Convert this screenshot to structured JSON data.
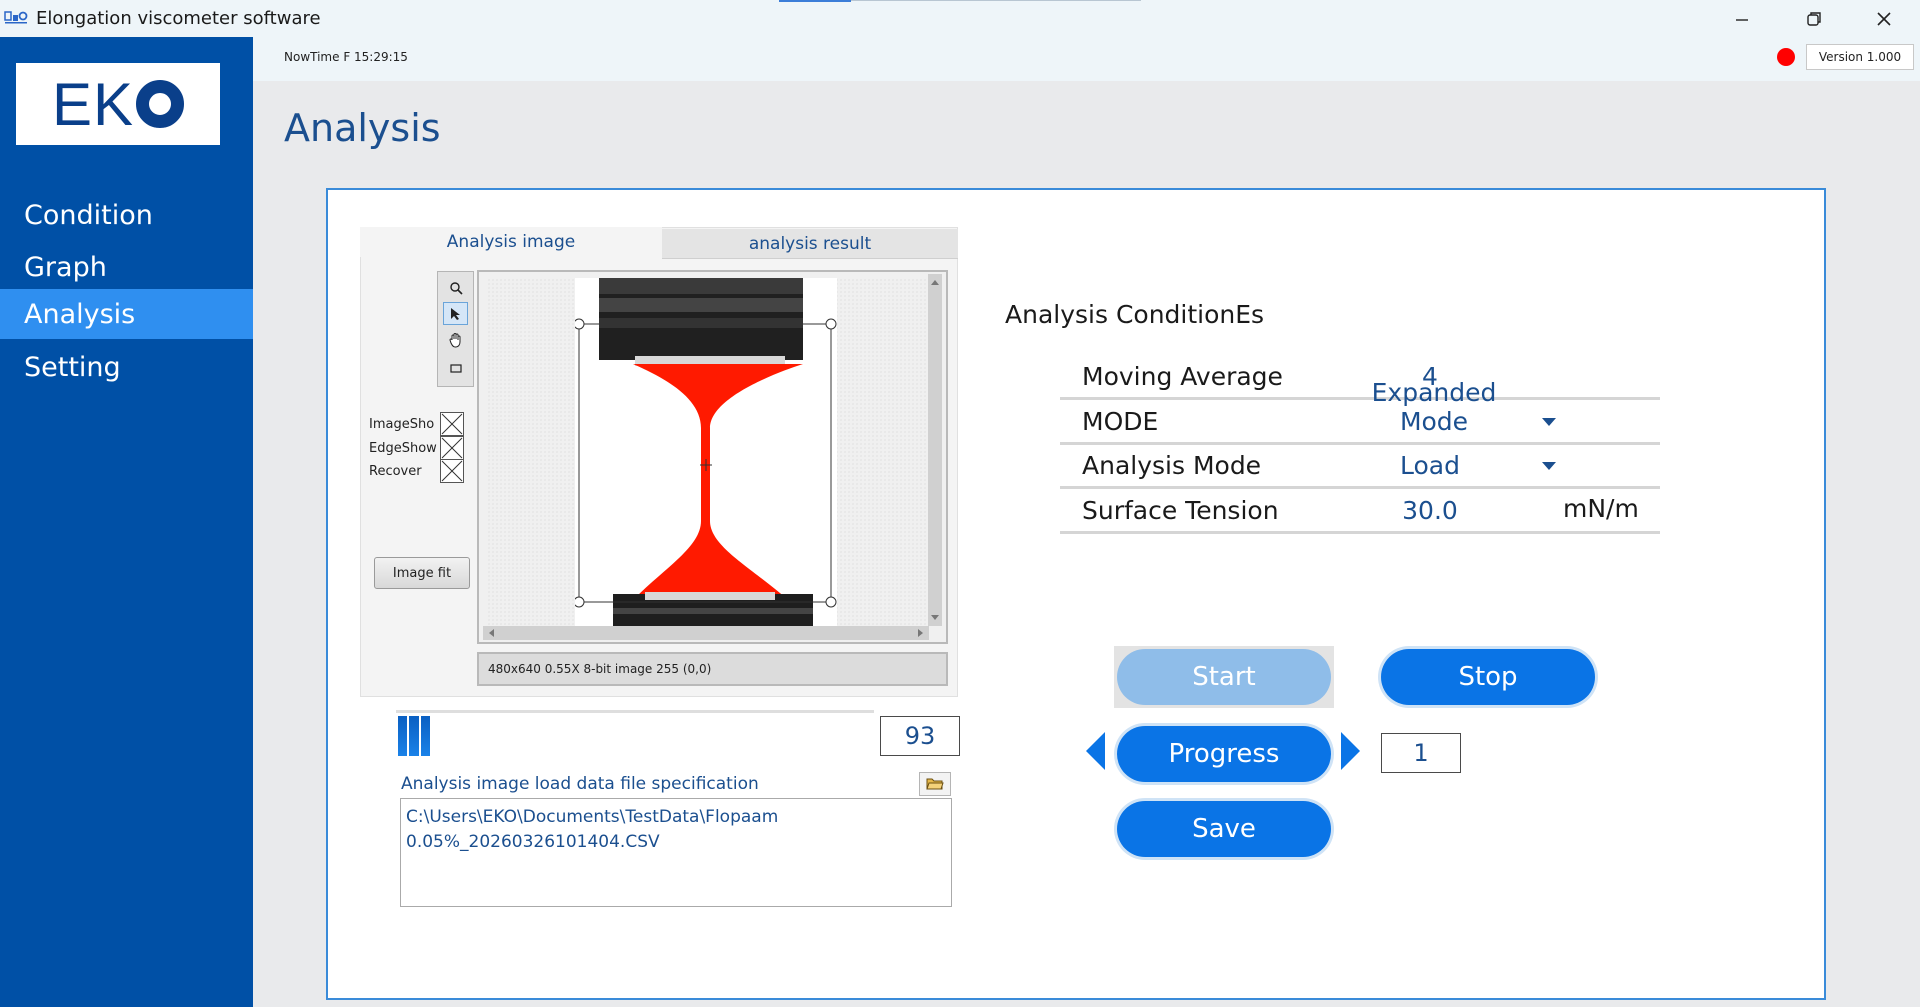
{
  "window": {
    "title": "Elongation viscometer software",
    "minimize_icon": "minimize-icon",
    "maximize_icon": "restore-icon",
    "close_icon": "close-icon"
  },
  "sidebar": {
    "logo_text": "EKO",
    "items": [
      {
        "label": "Condition",
        "active": false
      },
      {
        "label": "Graph",
        "active": false
      },
      {
        "label": "Analysis",
        "active": true
      },
      {
        "label": "Setting",
        "active": false
      }
    ]
  },
  "header": {
    "now_time": "NowTime F  15:29:15",
    "status_color": "#ff0000",
    "version": "Version 1.000"
  },
  "page_title": "Analysis",
  "tabs": [
    {
      "label": "Analysis image",
      "active": true
    },
    {
      "label": "analysis result",
      "active": false
    }
  ],
  "tools": [
    "zoom-icon",
    "pointer-icon",
    "hand-icon",
    "rectangle-icon"
  ],
  "checkboxes": [
    {
      "label": "ImageSho"
    },
    {
      "label": "EdgeShow"
    },
    {
      "label": "Recover"
    }
  ],
  "image_fit_label": "Image fit",
  "image_info": "480x640 0.55X 8-bit image 255    (0,0)",
  "frame_value": "93",
  "file_label": "Analysis image load data file specification",
  "file_path_line1": "C:\\Users\\EKO\\Documents\\TestData\\Flopaam",
  "file_path_line2": "0.05%_20260326101404.CSV",
  "conditions": {
    "title": "Analysis ConditionEs",
    "moving_average": {
      "label": "Moving Average",
      "value": "4"
    },
    "mode": {
      "label": "MODE",
      "value": "Expanded Mode"
    },
    "analysis_mode": {
      "label": "Analysis Mode",
      "value": "Load"
    },
    "surface_tension": {
      "label": "Surface Tension",
      "value": "30.0",
      "unit": "mN/m"
    }
  },
  "buttons": {
    "start": "Start",
    "stop": "Stop",
    "progress": "Progress",
    "save": "Save"
  },
  "step_value": "1",
  "colors": {
    "sidebar": "#0050a6",
    "accent": "#0a74e6",
    "text_blue": "#1b4f8f",
    "fluid_red": "#ff1a00"
  }
}
